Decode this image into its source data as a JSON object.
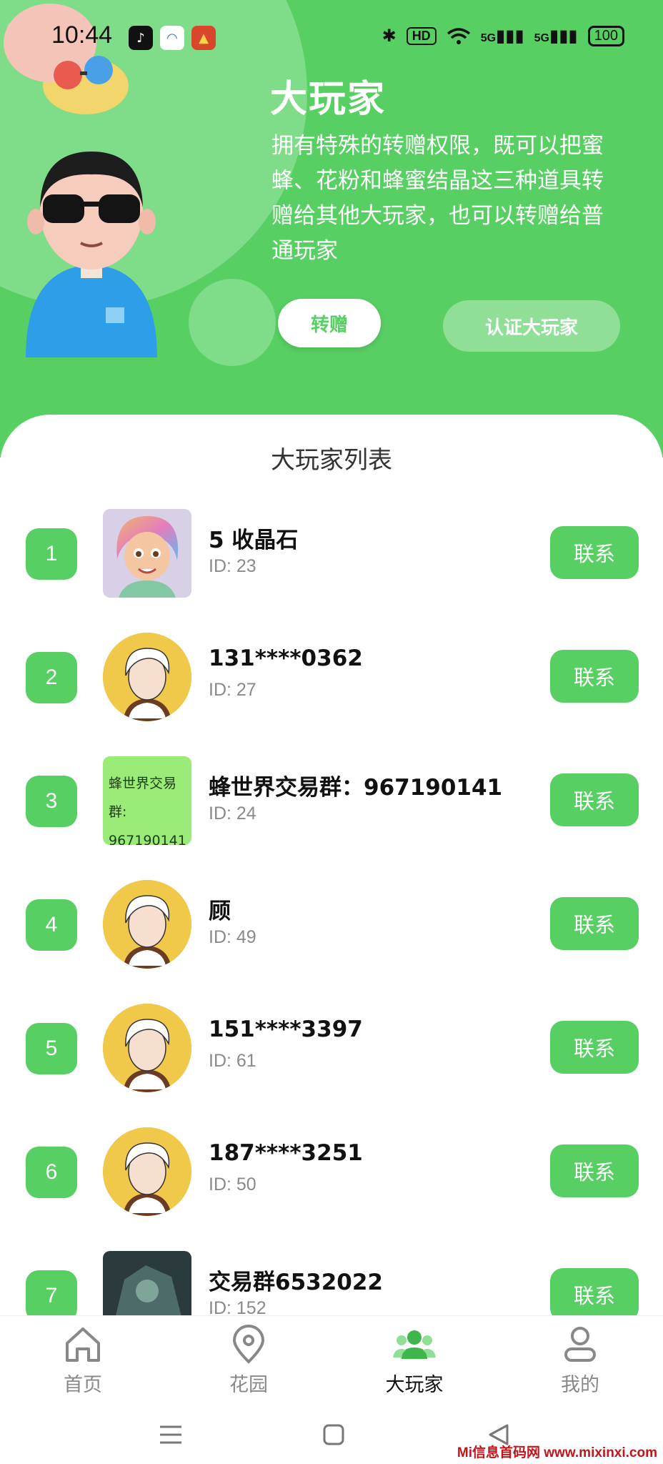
{
  "status_bar": {
    "time": "10:44",
    "hd": "HD",
    "net1": "5G",
    "net2": "5G",
    "battery": "100"
  },
  "hero": {
    "title": "大玩家",
    "description": "拥有特殊的转赠权限，既可以把蜜蜂、花粉和蜂蜜结晶这三种道具转赠给其他大玩家，也可以转赠给普通玩家",
    "gift_button": "转赠",
    "verify_button": "认证大玩家"
  },
  "list": {
    "title": "大玩家列表",
    "contact_label": "联系",
    "players": [
      {
        "rank": "1",
        "name": "5 收晶石",
        "id": "ID: 23",
        "avatar": "cartoon-girl"
      },
      {
        "rank": "2",
        "name": "131****0362",
        "id": "ID: 27",
        "avatar": "default-avatar"
      },
      {
        "rank": "3",
        "name": "蜂世界交易群：967190141",
        "id": "ID: 24",
        "avatar": "text-avatar"
      },
      {
        "rank": "4",
        "name": "顾",
        "id": "ID: 49",
        "avatar": "default-avatar"
      },
      {
        "rank": "5",
        "name": "151****3397",
        "id": "ID: 61",
        "avatar": "default-avatar"
      },
      {
        "rank": "6",
        "name": "187****3251",
        "id": "ID: 50",
        "avatar": "default-avatar"
      },
      {
        "rank": "7",
        "name": "交易群6532022",
        "id": "ID: 152",
        "avatar": "dark-robot"
      }
    ],
    "text_avatar": {
      "line1": "蜂世界交易群:",
      "line2": "967190141"
    }
  },
  "bottom_nav": [
    {
      "label": "首页",
      "icon": "home-icon"
    },
    {
      "label": "花园",
      "icon": "location-pin-icon"
    },
    {
      "label": "大玩家",
      "icon": "players-icon"
    },
    {
      "label": "我的",
      "icon": "user-icon"
    }
  ],
  "watermark": "Mi信息首码网 www.mixinxi.com",
  "colors": {
    "accent": "#57cf63",
    "accent_light": "#7fdc88"
  }
}
